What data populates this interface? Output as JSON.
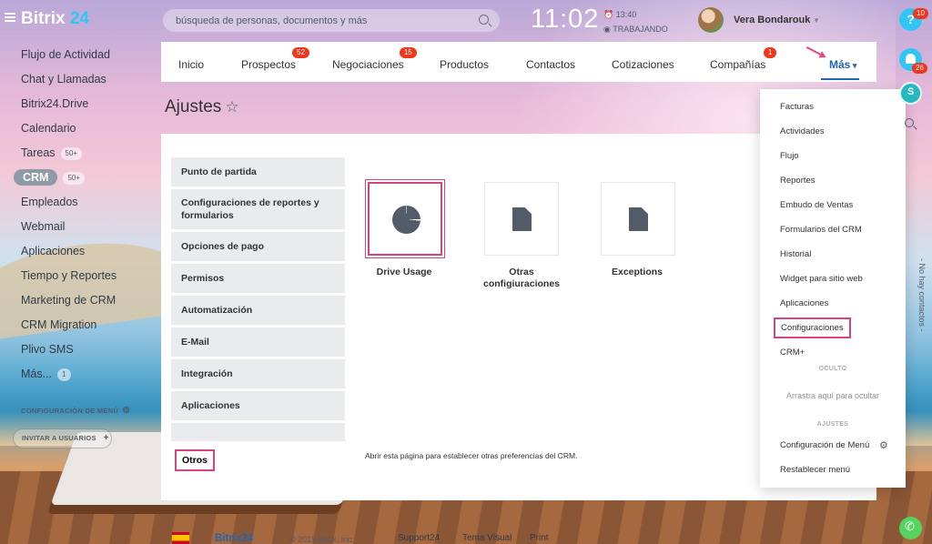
{
  "header": {
    "logo_text": "Bitrix",
    "logo_num": "24",
    "search_placeholder": "búsqueda de personas, documentos y más",
    "clock": "11:02",
    "clock_alarm": "13:40",
    "work_status": "TRABAJANDO",
    "user_name": "Vera Bondarouk"
  },
  "left_menu": {
    "items": [
      {
        "label": "Flujo de Actividad",
        "count": ""
      },
      {
        "label": "Chat y Llamadas",
        "count": ""
      },
      {
        "label": "Bitrix24.Drive",
        "count": ""
      },
      {
        "label": "Calendario",
        "count": ""
      },
      {
        "label": "Tareas",
        "count": "50+"
      },
      {
        "label": "CRM",
        "count": "50+"
      },
      {
        "label": "Empleados",
        "count": ""
      },
      {
        "label": "Webmail",
        "count": ""
      },
      {
        "label": "Aplicaciones",
        "count": ""
      },
      {
        "label": "Tiempo y Reportes",
        "count": ""
      },
      {
        "label": "Marketing de CRM",
        "count": ""
      },
      {
        "label": "CRM Migration",
        "count": ""
      },
      {
        "label": "Plivo SMS",
        "count": ""
      },
      {
        "label": "Más...",
        "count": "1"
      }
    ],
    "config_label": "CONFIGURACIÓN DE MENÚ",
    "invite_label": "INVITAR A USUARIOS"
  },
  "topnav": {
    "items": [
      {
        "label": "Inicio",
        "badge": ""
      },
      {
        "label": "Prospectos",
        "badge": "52"
      },
      {
        "label": "Negociaciones",
        "badge": "15"
      },
      {
        "label": "Productos",
        "badge": ""
      },
      {
        "label": "Contactos",
        "badge": ""
      },
      {
        "label": "Cotizaciones",
        "badge": ""
      },
      {
        "label": "Compañías",
        "badge": "1"
      },
      {
        "label": "Más",
        "badge": ""
      }
    ]
  },
  "page": {
    "title": "Ajustes",
    "description": "Abrir esta página para establecer otras preferencias del CRM."
  },
  "settings_tabs": [
    "Punto de partida",
    "Configuraciones de reportes y formularios",
    "Opciones de pago",
    "Permisos",
    "Automatización",
    "E-Mail",
    "Integración",
    "Aplicaciones"
  ],
  "selected_tab": "Otros",
  "tiles": [
    {
      "label": "Drive Usage",
      "icon": "pie-chart-icon"
    },
    {
      "label": "Otras configiuraciones",
      "icon": "document-icon"
    },
    {
      "label": "Exceptions",
      "icon": "document-icon"
    }
  ],
  "dropdown": {
    "items": [
      "Facturas",
      "Actividades",
      "Flujo",
      "Reportes",
      "Embudo de Ventas",
      "Formularios del CRM",
      "Historial",
      "Widget para sitio web",
      "Aplicaciones",
      "Configuraciones",
      "CRM+"
    ],
    "hidden_section": "OCULTO",
    "hidden_hint": "Arrastra aquí para ocultar",
    "settings_section": "AJUSTES",
    "menu_config": "Configuración de Menú",
    "reset_menu": "Restablecer menú"
  },
  "right_bar": {
    "help_badge": "10",
    "bell_badge": "26",
    "no_contacts": "- No hay contactos -"
  },
  "footer": {
    "logo": "Bitrix24",
    "copyright": "© 2019 Bitrix, Inc.",
    "links": [
      "Support24",
      "Tema Visual",
      "Print"
    ]
  },
  "colors": {
    "accent_blue": "#2066b0",
    "highlight_pink": "#d7437e",
    "badge_red": "#f0371d",
    "cyan": "#2fc6f6"
  }
}
